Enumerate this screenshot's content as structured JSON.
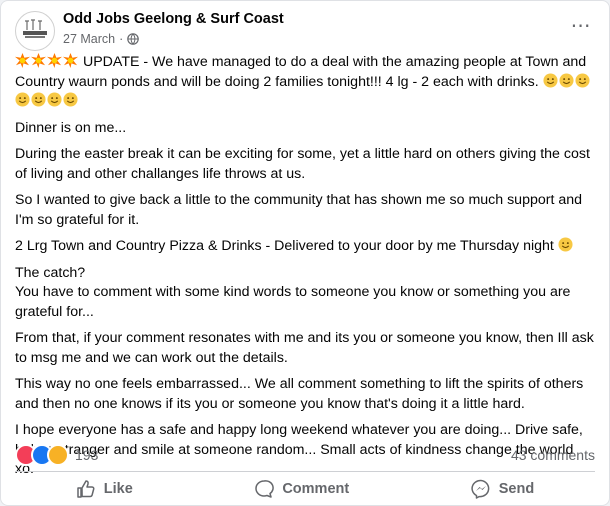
{
  "post": {
    "page_name": "Odd Jobs Geelong & Surf Coast",
    "date": "27 March",
    "separator": "·",
    "avatar_text": "ODD JOBS GEELONG & SURF COAST",
    "paragraphs": {
      "p1": "UPDATE - We have managed to do a deal with the amazing people at Town and Country waurn ponds and will be doing 2 families tonight!!! 4 lg - 2 each with drinks.",
      "p2": "Dinner is on me...",
      "p3": "During the easter break it can be exciting for some, yet a little hard on others giving the cost of living and other challanges life throws at us.",
      "p4": "So I wanted to give back a little to the community that has shown me so much support and I'm so grateful for it.",
      "p5": "2 Lrg Town and Country Pizza & Drinks - Delivered to your door by me Thursday night",
      "p6_line1": "The catch?",
      "p6_line2": "You have to comment with some kind words to someone you know or something you are grateful for...",
      "p7": "From that, if your comment resonates with me and its you or someone you know, then Ill ask to msg me and we can work out the details.",
      "p8": "This way no one feels embarrassed... We all comment something to lift the spirits of others and then no one knows if its you or someone you know that's doing it a little hard.",
      "p9": "I hope everyone has a safe and happy long weekend whatever you are doing... Drive safe, help a stranger and smile at someone random... Small acts of kindness change the world xo."
    }
  },
  "stats": {
    "reaction_count": "193",
    "comments": "43 comments",
    "reaction_icons": [
      "love-icon",
      "like-icon",
      "care-icon"
    ]
  },
  "actions": {
    "like": "Like",
    "comment": "Comment",
    "send": "Send"
  },
  "colors": {
    "secondary_text": "#65676b",
    "like_blue": "#1877f2",
    "love_red": "#f33e58",
    "care_yellow": "#f7b125",
    "explosion_orange": "#ff7a00"
  }
}
